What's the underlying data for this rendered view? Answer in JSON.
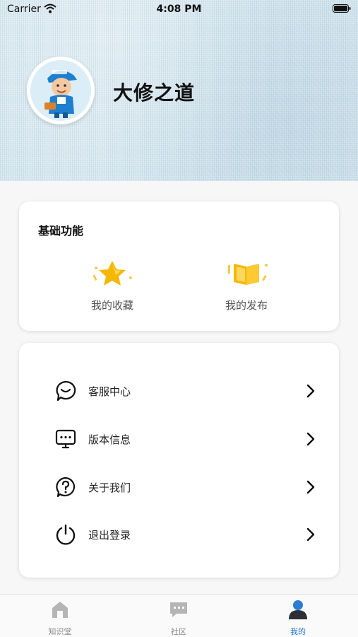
{
  "status_bar": {
    "carrier": "Carrier",
    "time": "4:08 PM"
  },
  "profile": {
    "username": "大修之道",
    "avatar_icon": "mechanic-avatar-icon"
  },
  "basic_functions": {
    "title": "基础功能",
    "items": [
      {
        "label": "我的收藏",
        "icon": "star-icon"
      },
      {
        "label": "我的发布",
        "icon": "book-icon"
      }
    ]
  },
  "menu": {
    "items": [
      {
        "label": "客服中心",
        "icon": "smile-chat-icon"
      },
      {
        "label": "版本信息",
        "icon": "monitor-icon"
      },
      {
        "label": "关于我们",
        "icon": "question-icon"
      },
      {
        "label": "退出登录",
        "icon": "power-icon"
      }
    ]
  },
  "tabs": [
    {
      "label": "知识堂",
      "icon": "home-icon",
      "active": false
    },
    {
      "label": "社区",
      "icon": "chat-icon",
      "active": false
    },
    {
      "label": "我的",
      "icon": "user-icon",
      "active": true
    }
  ],
  "colors": {
    "accent": "#2b7cd3",
    "header_bg": "#d5e6ef",
    "star": "#f5b800"
  }
}
